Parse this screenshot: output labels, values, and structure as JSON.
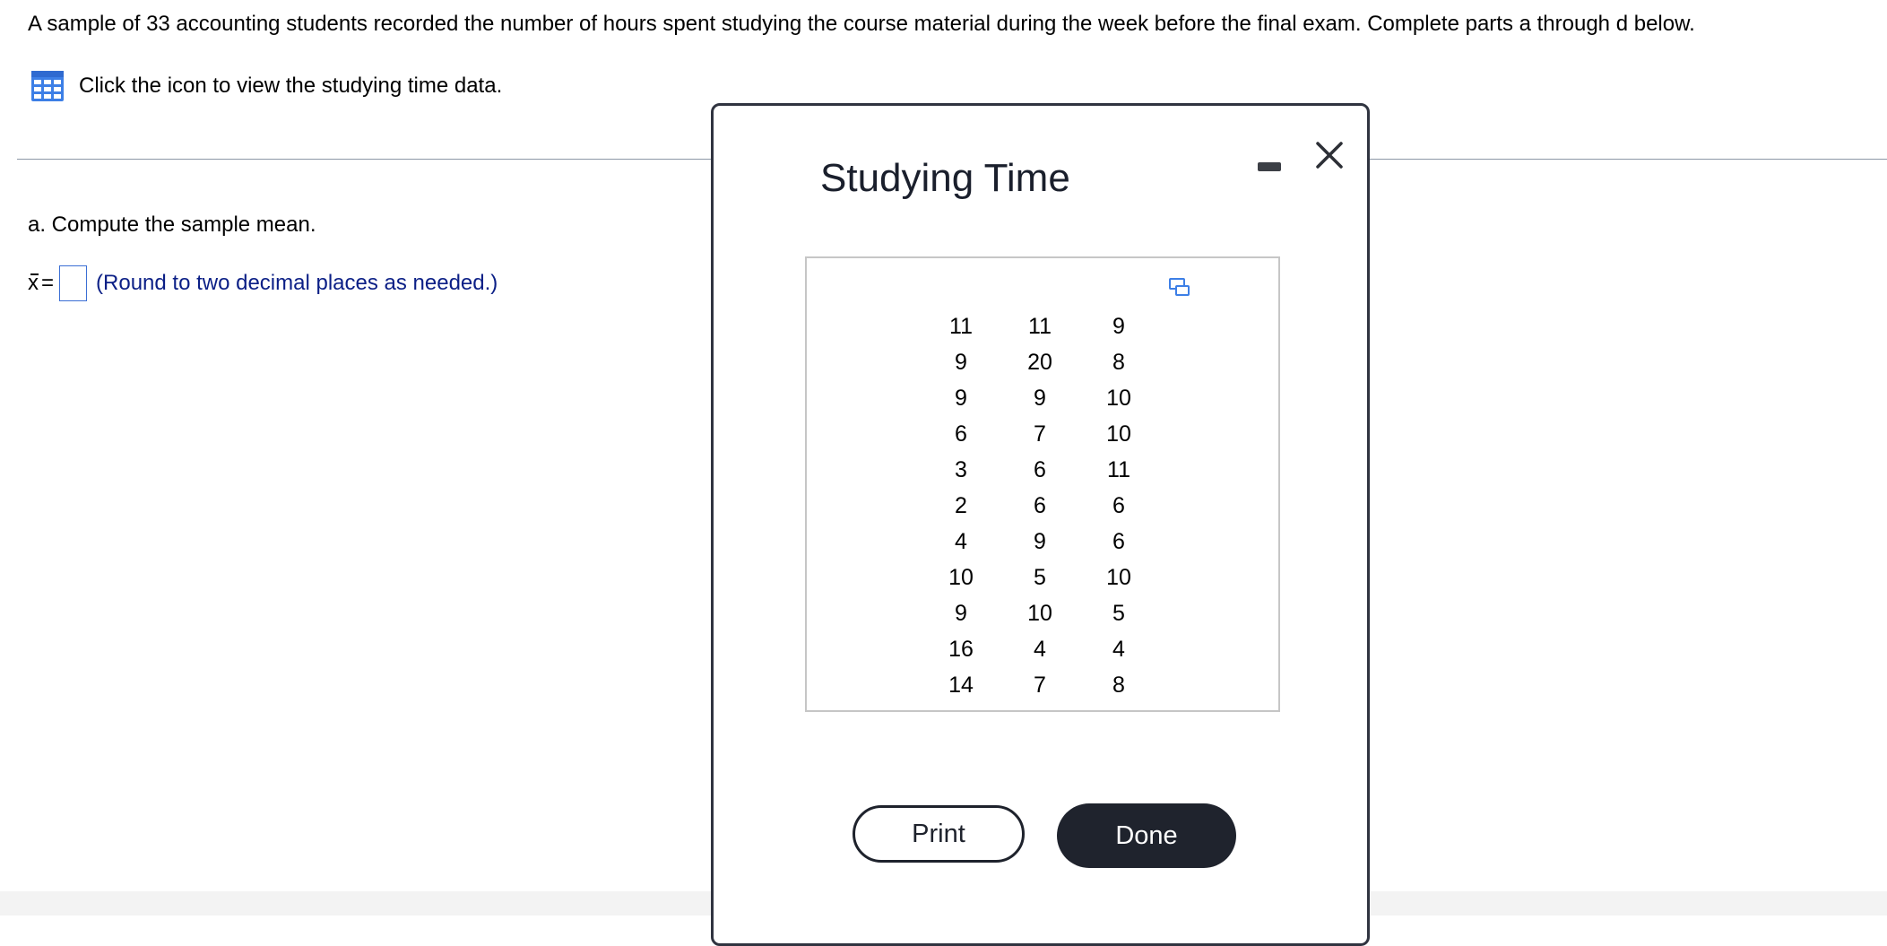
{
  "question": {
    "text": "A sample of 33 accounting students recorded the number of hours spent studying the course material during the week before the final exam. Complete parts a through d below.",
    "data_link_label": "Click the icon to view the studying time data.",
    "data_link_icon": "table-grid-icon"
  },
  "part_a": {
    "prompt": "a. Compute the sample mean.",
    "variable": "x",
    "equals": "=",
    "answer_value": "",
    "hint": "(Round to two decimal places as needed.)"
  },
  "colors": {
    "input_border": "#3b6fd4",
    "hint_text": "#0b1f86",
    "icon_blue": "#3d7fe6",
    "dialog_border": "#303440",
    "done_button_bg": "#1f232d"
  },
  "dialog": {
    "title": "Studying Time",
    "minimize_icon": "minimize-icon",
    "close_icon": "close-icon",
    "copy_icon": "copy-data-icon",
    "table": [
      [
        "11",
        "11",
        "9"
      ],
      [
        "9",
        "20",
        "8"
      ],
      [
        "9",
        "9",
        "10"
      ],
      [
        "6",
        "7",
        "10"
      ],
      [
        "3",
        "6",
        "11"
      ],
      [
        "2",
        "6",
        "6"
      ],
      [
        "4",
        "9",
        "6"
      ],
      [
        "10",
        "5",
        "10"
      ],
      [
        "9",
        "10",
        "5"
      ],
      [
        "16",
        "4",
        "4"
      ],
      [
        "14",
        "7",
        "8"
      ]
    ],
    "print_label": "Print",
    "done_label": "Done"
  }
}
